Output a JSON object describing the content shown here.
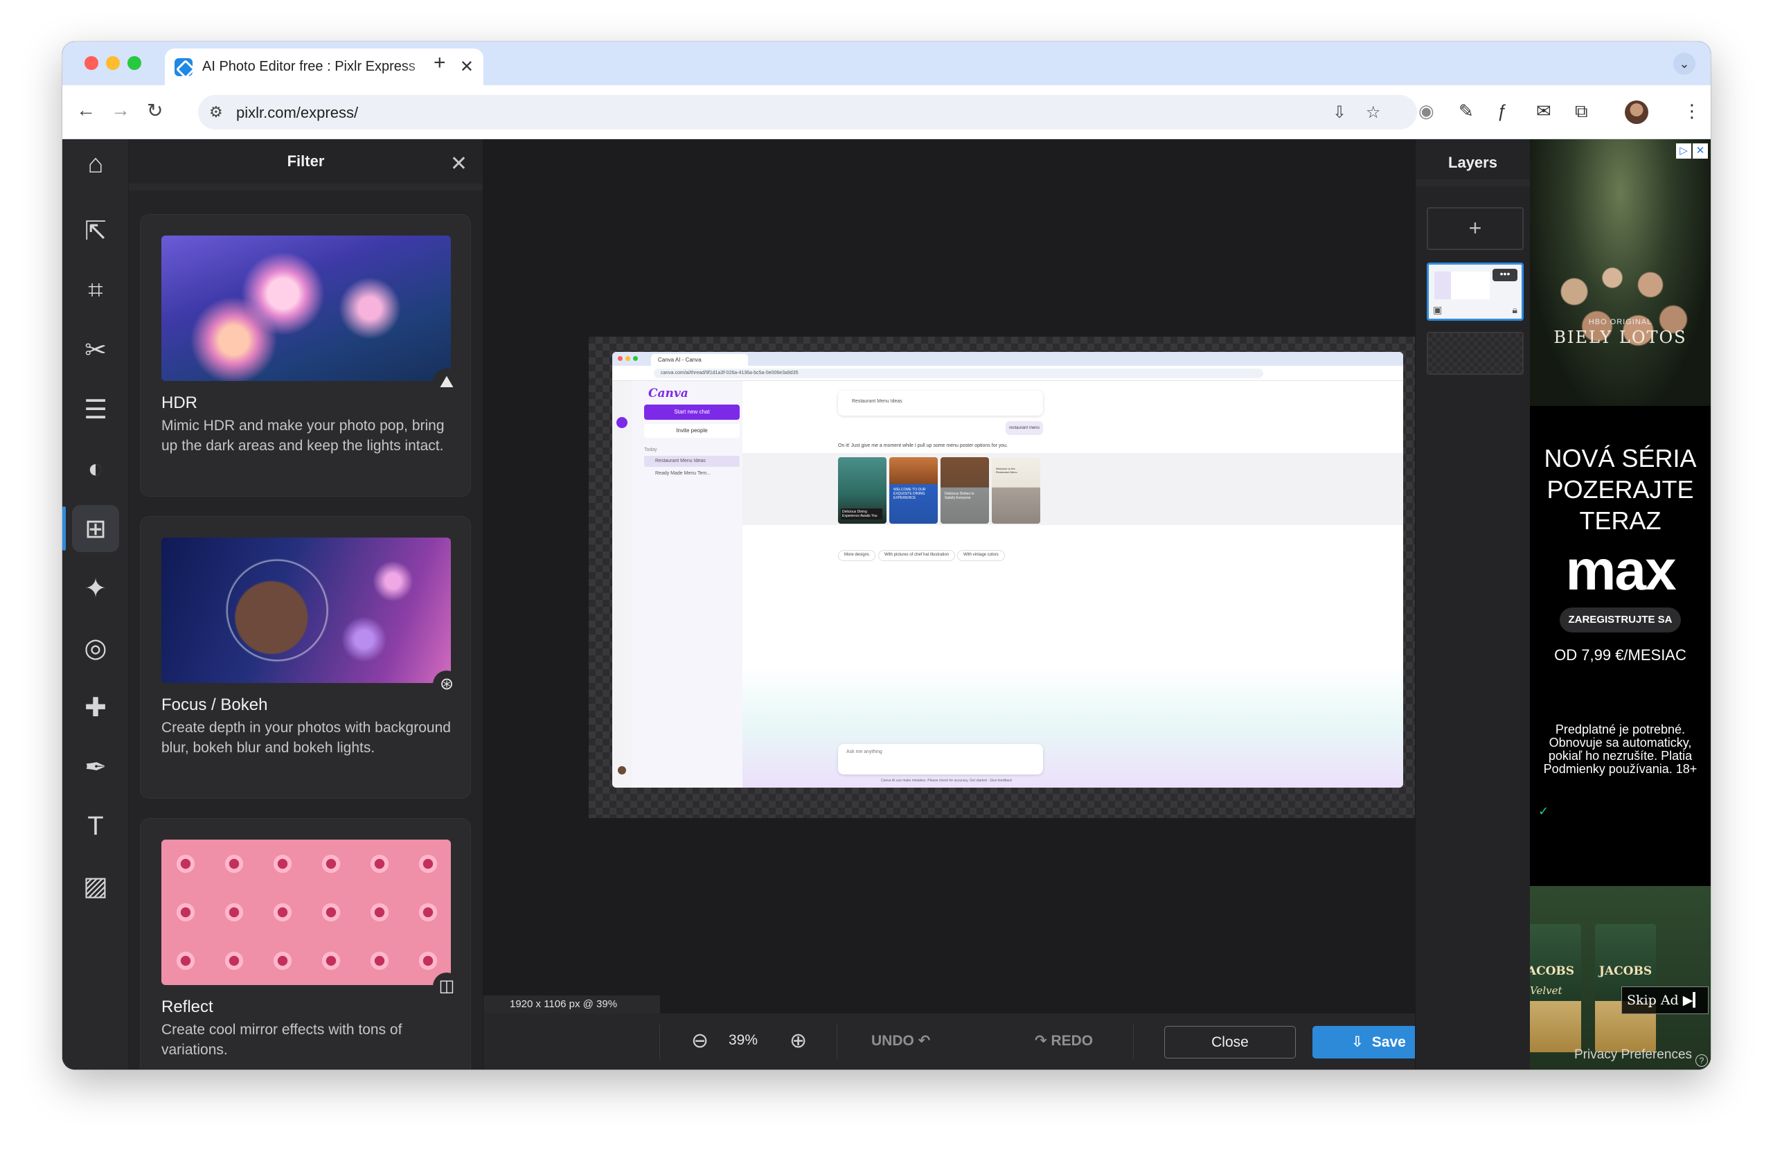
{
  "browser": {
    "tab_title": "AI Photo Editor free : Pixlr Express",
    "tab_close": "✕",
    "new_tab": "+",
    "url": "pixlr.com/express/"
  },
  "app": {
    "filter_panel": {
      "title": "Filter",
      "close": "✕",
      "cards": [
        {
          "title": "HDR",
          "description": "Mimic HDR and make your photo pop, bring up the dark areas and keep the lights intact.",
          "icon": "mountains-icon"
        },
        {
          "title": "Focus / Bokeh",
          "description": "Create depth in your photos with background blur, bokeh blur and bokeh lights.",
          "icon": "bokeh-icon"
        },
        {
          "title": "Reflect",
          "description": "Create cool mirror effects with tons of variations.",
          "icon": "mirror-icon"
        }
      ]
    },
    "tools": [
      "home-icon",
      "arrange-icon",
      "crop-icon",
      "cutout-icon",
      "adjust-icon",
      "filter-icon",
      "effect-icon",
      "liquify-icon",
      "heal-icon",
      "draw-icon",
      "text-icon",
      "elements-icon"
    ],
    "canvas": {
      "dimensions": "1920 x 1106 px @ 39%",
      "screenshot": {
        "tab": "Canva AI - Canva",
        "url": "canva.com/ai/thread/9f1d1a3f-026a-4136a-bc5a-0e006e3a9d35",
        "logo": "Canva",
        "start_chat": "Start new chat",
        "invite": "Invite people",
        "today": "Today",
        "history": [
          "Restaurant Menu Ideas",
          "Ready Made Menu Tem..."
        ],
        "prompt": "Restaurant Menu Ideas",
        "user_chip": "restaurant menu",
        "reply": "On it! Just give me a moment while I pull up some menu poster options for you.",
        "posters": [
          "Delicious Dining Experience Awaits You",
          "WELCOME TO OUR EXQUISITE DINING EXPERIENCE",
          "Delicious Dishes to Satisfy Everyone",
          "Welcome to the Restaurant Menu"
        ],
        "suggestions": [
          "More designs",
          "With pictures of chef hat illustration",
          "With vintage colors"
        ],
        "ask": "Ask me anything",
        "footer": "Canva AI can make mistakes. Please check for accuracy. Get started · Give feedback"
      }
    },
    "bottom_bar": {
      "zoom_value": "39%",
      "undo": "UNDO",
      "redo": "REDO",
      "close": "Close",
      "save": "Save"
    },
    "layers": {
      "title": "Layers",
      "add": "+",
      "more": "•••"
    },
    "ad": {
      "series_badge": "HBO ORIGINAL",
      "series_title": "BIELY LOTOS",
      "headline": "NOVÁ SÉRIA POZERAJTE TERAZ",
      "brand": "max",
      "cta": "ZAREGISTRUJTE SA",
      "price": "OD 7,99 €/MESIAC",
      "fine_print": "Predplatné je potrebné. Obnovuje sa automaticky, pokiaľ ho nezrušíte. Platia Podmienky používania. 18+",
      "coffee_brand": "JACOBS",
      "coffee_left": "ACOBS",
      "coffee_variant": "Velvet",
      "skip": "Skip Ad ▶▎",
      "privacy": "Privacy Preferences"
    }
  }
}
